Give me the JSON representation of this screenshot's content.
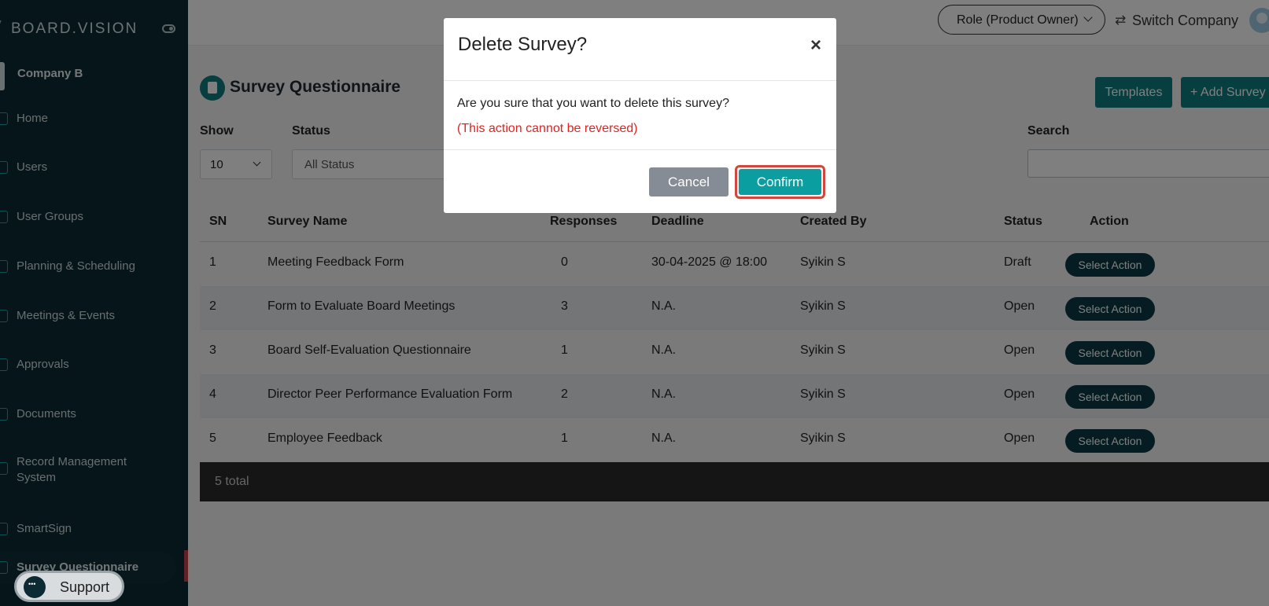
{
  "sidebar": {
    "brand": "BOARD.VISION",
    "company": "Company B",
    "items": [
      {
        "label": "Home",
        "icon": "home-icon"
      },
      {
        "label": "Users",
        "icon": "user-icon"
      },
      {
        "label": "User Groups",
        "icon": "user-group-icon"
      },
      {
        "label": "Planning & Scheduling",
        "icon": "calendar-icon"
      },
      {
        "label": "Meetings & Events",
        "icon": "meeting-icon"
      },
      {
        "label": "Approvals",
        "icon": "approval-icon"
      },
      {
        "label": "Documents",
        "icon": "document-icon"
      },
      {
        "label": "Record Management System",
        "icon": "record-icon"
      },
      {
        "label": "SmartSign",
        "icon": "signature-icon"
      },
      {
        "label": "Survey Questionnaire",
        "icon": "survey-icon"
      }
    ],
    "support_label": "Support"
  },
  "topbar": {
    "role": "Role (Product Owner)",
    "switch_company": "Switch Company"
  },
  "page": {
    "title": "Survey Questionnaire",
    "templates_label": "Templates",
    "add_label": "+ Add Survey",
    "show_label": "Show",
    "show_value": "10",
    "status_label": "Status",
    "status_value": "All Status",
    "search_label": "Search",
    "search_value": ""
  },
  "table": {
    "headers": [
      "SN",
      "Survey Name",
      "Responses",
      "Deadline",
      "Created By",
      "Status",
      "Action"
    ],
    "rows": [
      {
        "sn": "1",
        "name": "Meeting Feedback Form",
        "responses": "0",
        "deadline": "30-04-2025 @ 18:00",
        "created_by": "Syikin S",
        "status": "Draft",
        "action": "Select Action"
      },
      {
        "sn": "2",
        "name": "Form to Evaluate Board Meetings",
        "responses": "3",
        "deadline": "N.A.",
        "created_by": "Syikin S",
        "status": "Open",
        "action": "Select Action"
      },
      {
        "sn": "3",
        "name": "Board Self-Evaluation Questionnaire",
        "responses": "1",
        "deadline": "N.A.",
        "created_by": "Syikin S",
        "status": "Open",
        "action": "Select Action"
      },
      {
        "sn": "4",
        "name": "Director Peer Performance Evaluation Form",
        "responses": "2",
        "deadline": "N.A.",
        "created_by": "Syikin S",
        "status": "Open",
        "action": "Select Action"
      },
      {
        "sn": "5",
        "name": "Employee Feedback",
        "responses": "1",
        "deadline": "N.A.",
        "created_by": "Syikin S",
        "status": "Open",
        "action": "Select Action"
      }
    ],
    "total": "5 total"
  },
  "modal": {
    "title": "Delete Survey?",
    "close": "×",
    "message": "Are you sure that you want to delete this survey?",
    "warning": "(This action cannot be reversed)",
    "cancel": "Cancel",
    "confirm": "Confirm"
  },
  "colors": {
    "sidebar_bg": "#0b2a33",
    "accent_teal": "#0f7d80",
    "confirm_teal": "#0b9ea0",
    "warning_red": "#e02424",
    "highlight_red": "#d1473e"
  }
}
